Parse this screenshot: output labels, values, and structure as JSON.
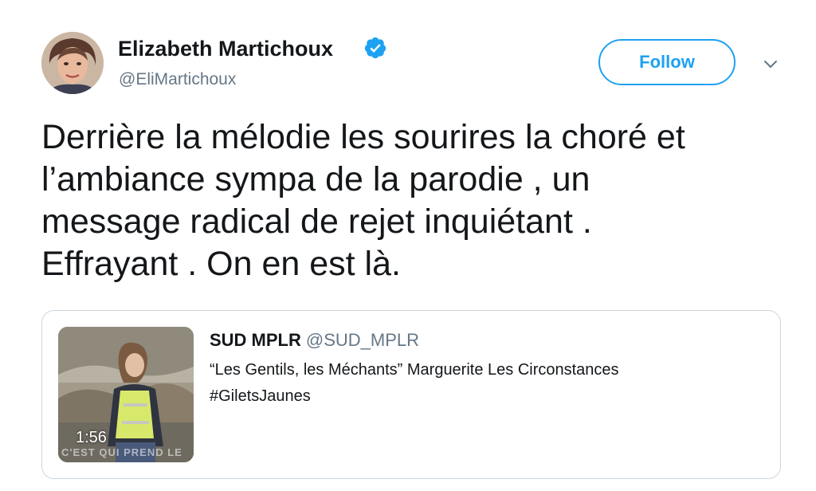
{
  "tweet": {
    "author": {
      "name": "Elizabeth Martichoux",
      "handle": "@EliMartichoux",
      "verified": true
    },
    "follow_label": "Follow",
    "text_lines": [
      "Derrière la mélodie les sourires la choré et",
      "l’ambiance sympa de la parodie , un",
      "message radical de rejet inquiétant .",
      "Effrayant . On en est là."
    ]
  },
  "quoted_tweet": {
    "author_name": "SUD MPLR",
    "author_handle": "@SUD_MPLR",
    "text_lines": [
      "“Les Gentils, les Méchants” Marguerite Les Circonstances",
      "#GiletsJaunes"
    ],
    "video_duration": "1:56",
    "video_overlay_text": "C'EST QUI PREND LE"
  },
  "colors": {
    "accent": "#1da1f2",
    "text_primary": "#14171a",
    "text_secondary": "#657786",
    "border": "#ccd6dd"
  },
  "icons": {
    "verified": "verified-badge-icon",
    "more": "chevron-down-icon"
  }
}
